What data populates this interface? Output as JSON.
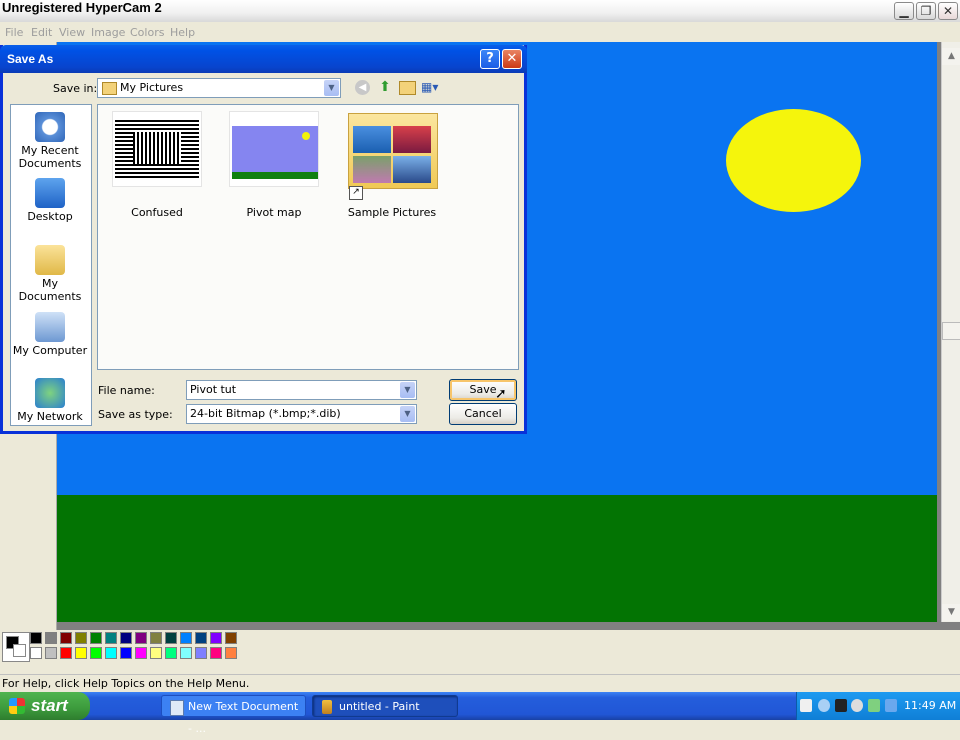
{
  "recorder_banner": "Unregistered HyperCam 2",
  "menu": [
    "File",
    "Edit",
    "View",
    "Image",
    "Colors",
    "Help"
  ],
  "status_text": "For Help, click Help Topics on the Help Menu.",
  "dialog": {
    "title": "Save As",
    "help_glyph": "?",
    "close_glyph": "✕",
    "save_in_label": "Save in:",
    "save_in_value": "My Pictures",
    "places": [
      "My Recent Documents",
      "Desktop",
      "My Documents",
      "My Computer",
      "My Network"
    ],
    "files": [
      "Confused",
      "Pivot map",
      "Sample Pictures"
    ],
    "file_name_label": "File name:",
    "file_name_value": "Pivot tut",
    "save_type_label": "Save as type:",
    "save_type_value": "24-bit Bitmap (*.bmp;*.dib)",
    "save_button": "Save",
    "cancel_button": "Cancel"
  },
  "palette": [
    "#000000",
    "#808080",
    "#800000",
    "#808000",
    "#008000",
    "#008080",
    "#000080",
    "#800080",
    "#808040",
    "#004040",
    "#0080ff",
    "#004080",
    "#8000ff",
    "#804000",
    "#ffffff",
    "#c0c0c0",
    "#ff0000",
    "#ffff00",
    "#00ff00",
    "#00ffff",
    "#0000ff",
    "#ff00ff",
    "#ffff80",
    "#00ff80",
    "#80ffff",
    "#8080ff",
    "#ff0080",
    "#ff8040"
  ],
  "colors": {
    "sky": "#0a74f1",
    "grass": "#037403",
    "sun": "#f5f50c",
    "title_blue": "#0a5fe8",
    "taskbar": "#245edc",
    "start_green": "#3c9a3c"
  },
  "taskbar": {
    "start": "start",
    "tasks": [
      "New Text Document - ...",
      "untitled - Paint"
    ],
    "clock": "11:49 AM"
  }
}
